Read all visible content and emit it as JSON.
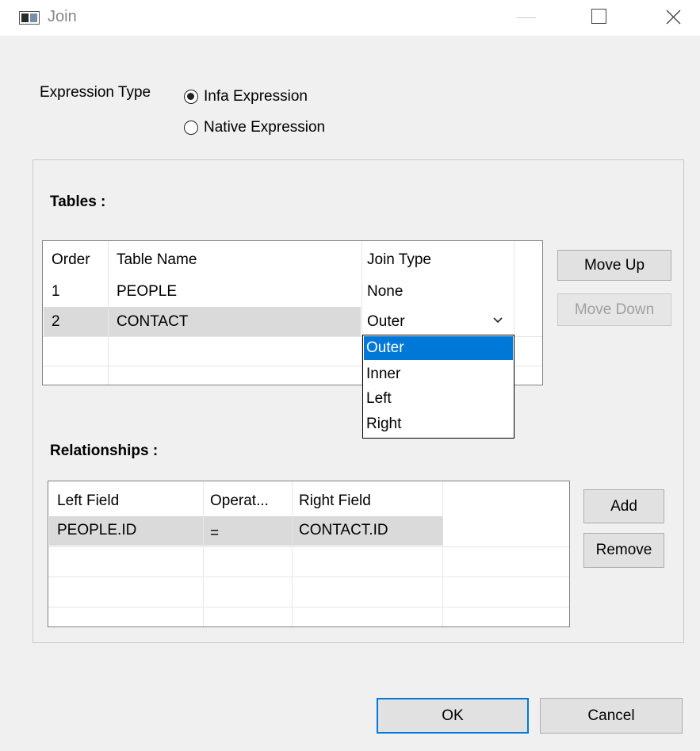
{
  "window": {
    "title": "Join"
  },
  "expression": {
    "label": "Expression Type",
    "options": [
      {
        "label": "Infa Expression",
        "checked": true
      },
      {
        "label": "Native Expression",
        "checked": false
      }
    ]
  },
  "tables": {
    "label": "Tables :",
    "columns": [
      "Order",
      "Table Name",
      "Join Type"
    ],
    "rows": [
      {
        "order": "1",
        "name": "PEOPLE",
        "join": "None"
      },
      {
        "order": "2",
        "name": "CONTACT",
        "join": "Outer"
      }
    ],
    "join_options": [
      "Outer",
      "Inner",
      "Left",
      "Right"
    ],
    "move_up": "Move Up",
    "move_down": "Move Down"
  },
  "relationships": {
    "label": "Relationships :",
    "columns": [
      "Left Field",
      "Operat...",
      "Right Field"
    ],
    "rows": [
      {
        "left": "PEOPLE.ID",
        "op": "=",
        "right": "CONTACT.ID"
      }
    ],
    "add": "Add",
    "remove": "Remove"
  },
  "footer": {
    "ok": "OK",
    "cancel": "Cancel"
  },
  "colors": {
    "selection": "#0078d7",
    "selected_row": "#dadada",
    "default_button_border": "#0078d7"
  }
}
